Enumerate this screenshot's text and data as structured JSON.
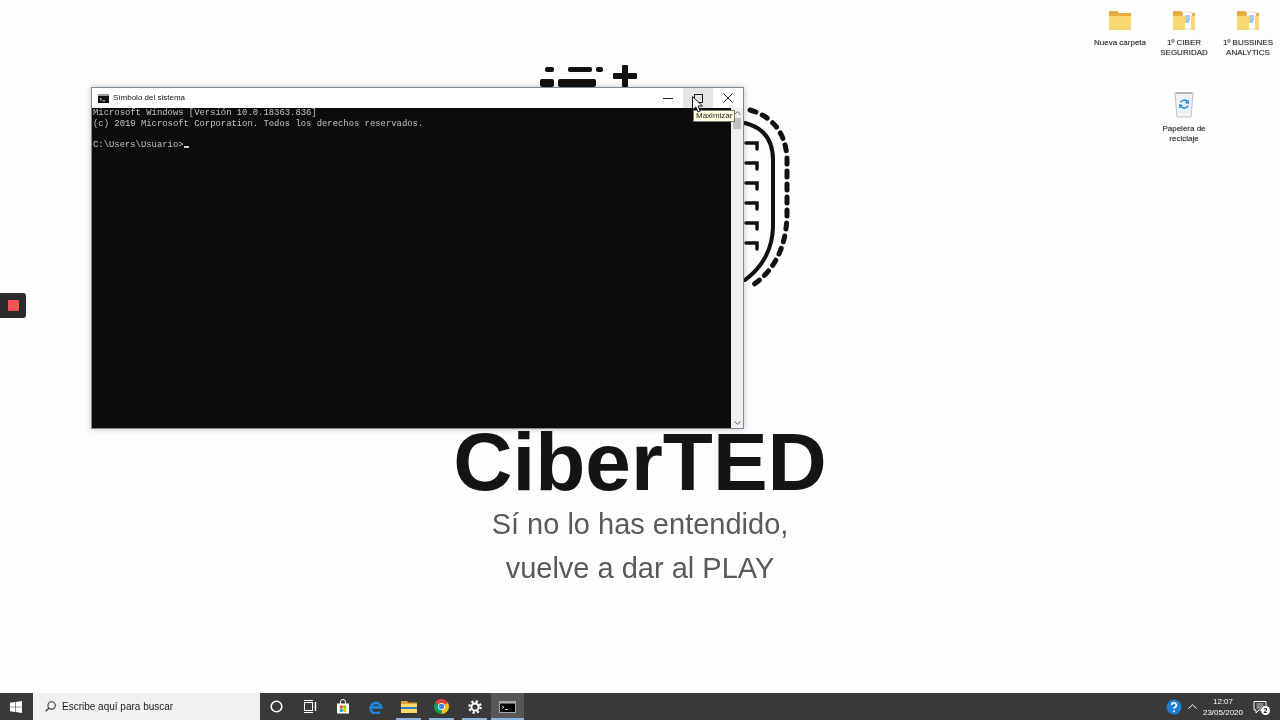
{
  "desktop": {
    "icons": [
      {
        "kind": "folder-empty",
        "label": "Nueva carpeta"
      },
      {
        "kind": "folder",
        "label": "1º CIBER SEGURIDAD"
      },
      {
        "kind": "folder",
        "label": "1º BUSSINES ANALYTICS"
      },
      {
        "kind": "recycle-bin",
        "label": "Papelera de reciclaje"
      }
    ]
  },
  "wallpaper": {
    "title": "CiberTED",
    "caption": "Sí no lo has entendido, vuelve a dar al PLAY"
  },
  "window": {
    "title": "Símbolo del sistema",
    "controls": [
      {
        "kind": "minimize",
        "hovered": false
      },
      {
        "kind": "maximize",
        "hovered": true
      },
      {
        "kind": "close",
        "hovered": false
      }
    ],
    "tooltip": "Maximizar",
    "console": {
      "banner": [
        "Microsoft Windows [Versión 10.0.18363.836]",
        "(c) 2019 Microsoft Corporation. Todos los derechos reservados."
      ],
      "prompt": "C:\\Users\\Usuario>"
    }
  },
  "taskbar": {
    "search": {
      "placeholder": "Escribe aquí para buscar"
    },
    "apps": [
      {
        "kind": "cortana",
        "running": false,
        "selected": false
      },
      {
        "kind": "task-view",
        "running": false,
        "selected": false
      },
      {
        "kind": "store",
        "running": false,
        "selected": false
      },
      {
        "kind": "edge",
        "running": false,
        "selected": false
      },
      {
        "kind": "explorer",
        "running": true,
        "selected": false
      },
      {
        "kind": "chrome",
        "running": true,
        "selected": false
      },
      {
        "kind": "settings",
        "running": true,
        "selected": false
      },
      {
        "kind": "terminal",
        "running": true,
        "selected": true
      }
    ],
    "clock": {
      "time": "12:07",
      "date": "23/05/2020"
    },
    "notifications": {
      "count": "2"
    }
  }
}
